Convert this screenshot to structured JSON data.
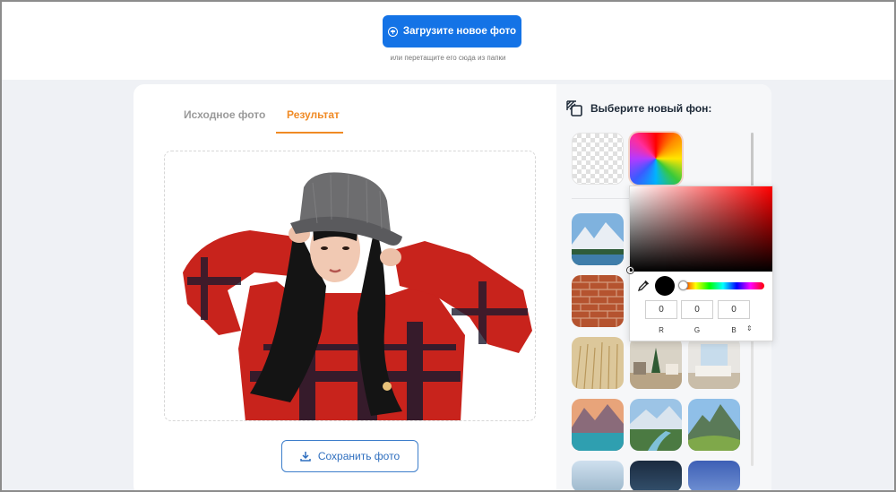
{
  "header": {
    "upload_label": "Загрузите новое фото",
    "upload_hint": "или перетащите его сюда из папки"
  },
  "tabs": [
    {
      "label": "Исходное фото",
      "active": false
    },
    {
      "label": "Результат",
      "active": true
    }
  ],
  "save_label": "Сохранить фото",
  "panel": {
    "title": "Выберите новый фон:",
    "backgrounds": [
      {
        "name": "transparent"
      },
      {
        "name": "custom-color"
      },
      {
        "name": "mountain-lake"
      },
      {
        "name": "brick-wall"
      },
      {
        "name": "wheat-field"
      },
      {
        "name": "living-room-christmas"
      },
      {
        "name": "living-room-bright"
      },
      {
        "name": "mountain-lake-sunset"
      },
      {
        "name": "mountain-river"
      },
      {
        "name": "green-mountains"
      }
    ]
  },
  "color_picker": {
    "r": "0",
    "g": "0",
    "b": "0",
    "r_label": "R",
    "g_label": "G",
    "b_label": "B",
    "toggle_glyph": "⇕",
    "current_color": "#000000"
  },
  "colors": {
    "accent_blue": "#1473e6",
    "accent_orange": "#f08a24",
    "sweater_red": "#c8231c"
  }
}
